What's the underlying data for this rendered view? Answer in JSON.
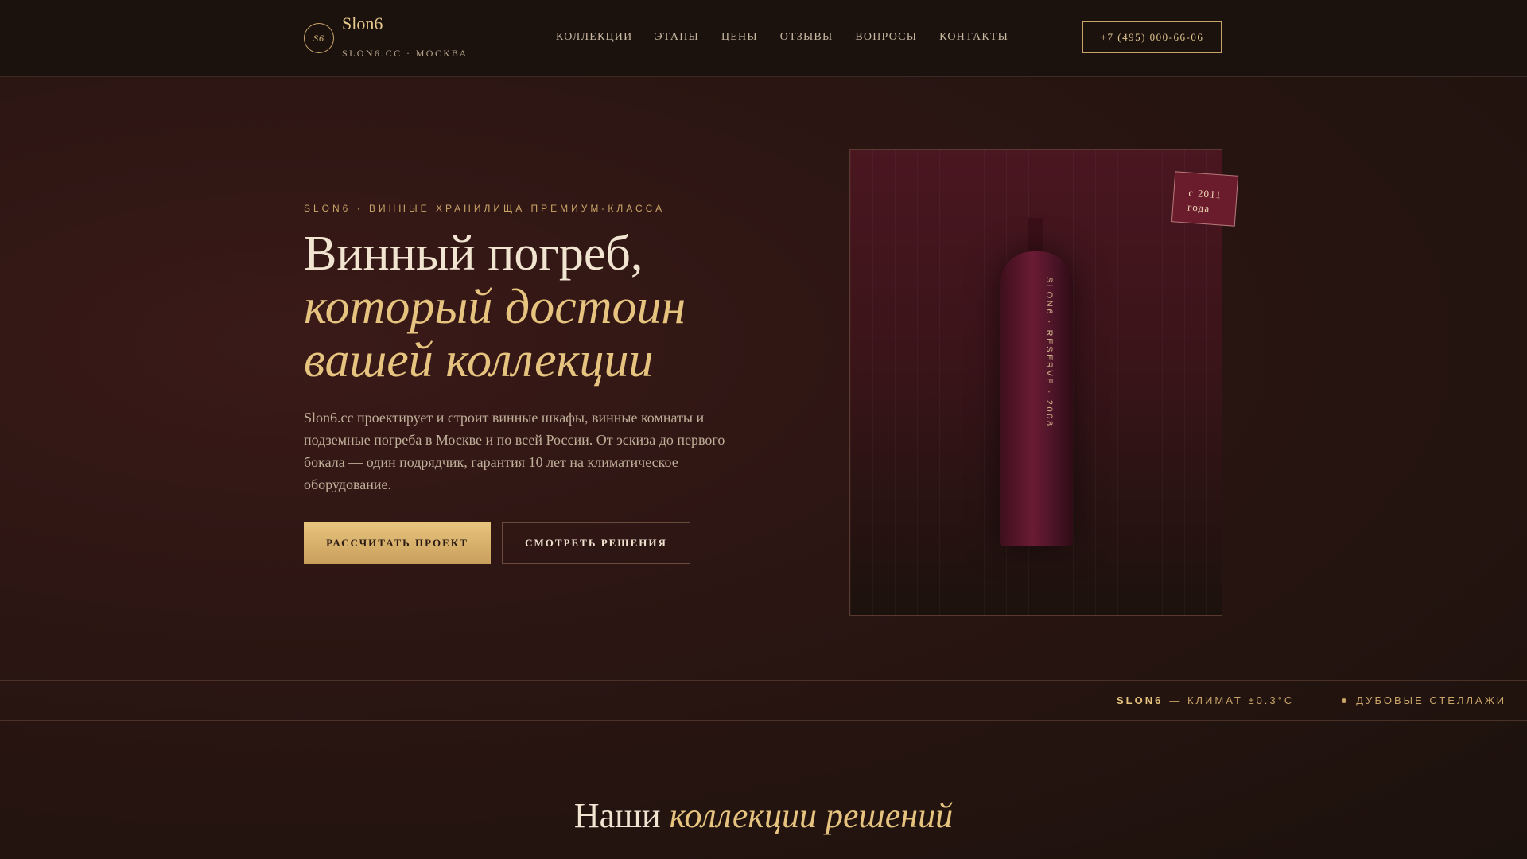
{
  "header": {
    "logo_mark": "S6",
    "logo_name": "Slon6",
    "logo_sub": "SLON6.CC · МОСКВА",
    "nav": [
      "КОЛЛЕКЦИИ",
      "ЭТАПЫ",
      "ЦЕНЫ",
      "ОТЗЫВЫ",
      "ВОПРОСЫ",
      "КОНТАКТЫ"
    ],
    "phone": "+7 (495) 000-66-06"
  },
  "hero": {
    "eyebrow": "SLON6 · ВИННЫЕ ХРАНИЛИЩА ПРЕМИУМ-КЛАССА",
    "title_line1": "Винный погреб,",
    "title_line2": "который достоин",
    "title_line3": "вашей коллекции",
    "lead": "Slon6.cc проектирует и строит винные шкафы, винные комнаты и подземные погреба в Москве и по всей России. От эскиза до первого бокала — один подрядчик, гарантия 10 лет на климатическое оборудование.",
    "btn_primary": "РАССЧИТАТЬ ПРОЕКТ",
    "btn_secondary": "СМОТРЕТЬ РЕШЕНИЯ",
    "bottle_label": "SLON6 · RESERVE · 2008",
    "since_line1": "с 2011",
    "since_line2": "года"
  },
  "marquee": {
    "brand": "SLON6",
    "item1": "— КЛИМАТ ±0.3°C",
    "item2": "ДУБОВЫЕ СТЕЛЛАЖИ"
  },
  "section": {
    "title_plain": "Наши",
    "title_accent": "коллекции решений"
  }
}
